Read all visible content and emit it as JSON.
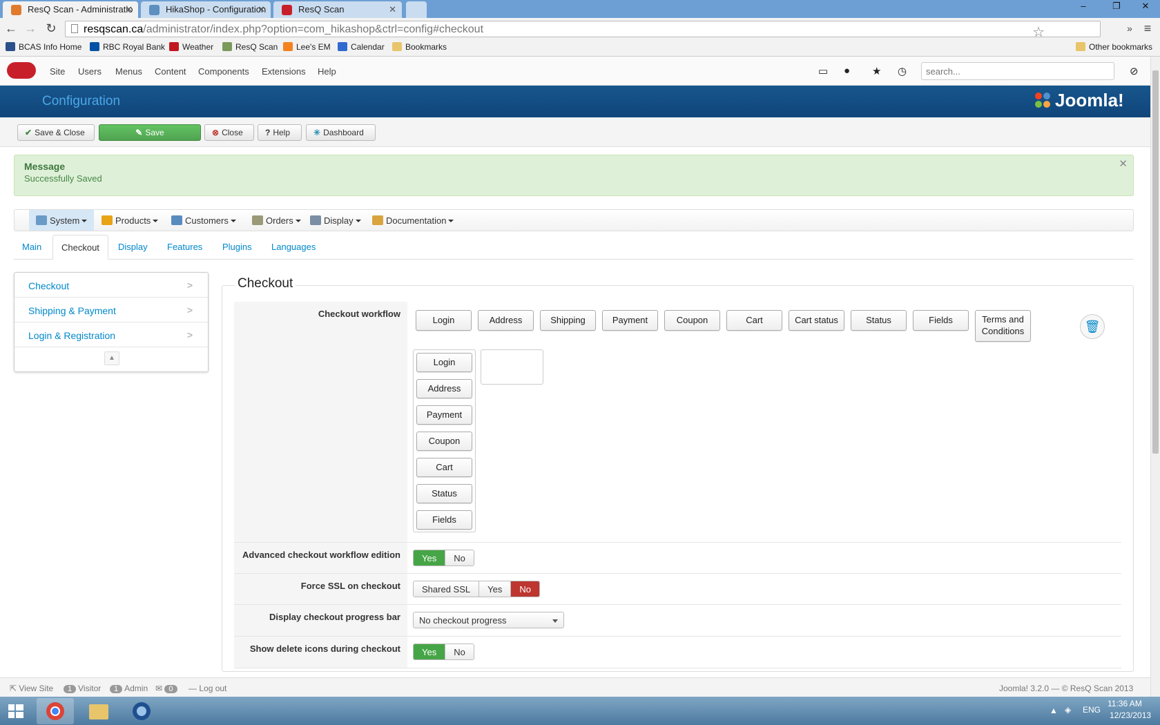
{
  "browser": {
    "tabs": [
      {
        "title": "ResQ Scan - Administratio",
        "active": true
      },
      {
        "title": "HikaShop - Configuration",
        "active": false
      },
      {
        "title": "ResQ Scan",
        "active": false
      }
    ],
    "url_host": "resqscan.ca",
    "url_path": "/administrator/index.php?option=com_hikashop&ctrl=config#checkout",
    "bookmarks": [
      "BCAS Info Home",
      "RBC Royal Bank",
      "Weather",
      "ResQ Scan",
      "Lee's EM",
      "Calendar",
      "Bookmarks"
    ],
    "other_bookmarks": "Other bookmarks"
  },
  "joomla": {
    "top_menu": [
      "Site",
      "Users",
      "Menus",
      "Content",
      "Components",
      "Extensions",
      "Help"
    ],
    "search_placeholder": "search...",
    "page_title": "Configuration",
    "brand": "Joomla!",
    "toolbar": {
      "save_close": "Save & Close",
      "save": "Save",
      "close": "Close",
      "help": "Help",
      "dashboard": "Dashboard"
    },
    "message": {
      "title": "Message",
      "text": "Successfully Saved"
    },
    "hika_menu": [
      "System",
      "Products",
      "Customers",
      "Orders",
      "Display",
      "Documentation"
    ],
    "tabs": [
      "Main",
      "Checkout",
      "Display",
      "Features",
      "Plugins",
      "Languages"
    ],
    "active_tab": "Checkout",
    "sidenav": [
      "Checkout",
      "Shipping & Payment",
      "Login & Registration"
    ]
  },
  "checkout": {
    "legend": "Checkout",
    "workflow_label": "Checkout workflow",
    "workflow_buttons": [
      "Login",
      "Address",
      "Shipping",
      "Payment",
      "Coupon",
      "Cart",
      "Cart status",
      "Status",
      "Fields"
    ],
    "terms_line1": "Terms and",
    "terms_line2": "Conditions",
    "workflow_steps": [
      "Login",
      "Address",
      "Payment",
      "Coupon",
      "Cart",
      "Status",
      "Fields"
    ],
    "advanced_label": "Advanced checkout workflow edition",
    "advanced_value": "Yes",
    "ssl_label": "Force SSL on checkout",
    "ssl_options": [
      "Shared SSL",
      "Yes",
      "No"
    ],
    "ssl_value": "No",
    "progress_label": "Display checkout progress bar",
    "progress_value": "No checkout progress",
    "delete_icons_label": "Show delete icons during checkout",
    "delete_icons_value": "Yes",
    "yes": "Yes",
    "no": "No"
  },
  "statusbar": {
    "view_site": "View Site",
    "visitor_count": "1",
    "visitor": "Visitor",
    "admin_count": "1",
    "admin": "Admin",
    "msg_count": "0",
    "logout": "Log out",
    "version": "Joomla! 3.2.0 — © ResQ Scan 2013"
  },
  "taskbar": {
    "lang": "ENG",
    "time": "11:36 AM",
    "date": "12/23/2013"
  },
  "colors": {
    "header_blue": "#10457a",
    "success_green": "#51a351",
    "danger_red": "#bd362f",
    "link_blue": "#0088cc"
  }
}
